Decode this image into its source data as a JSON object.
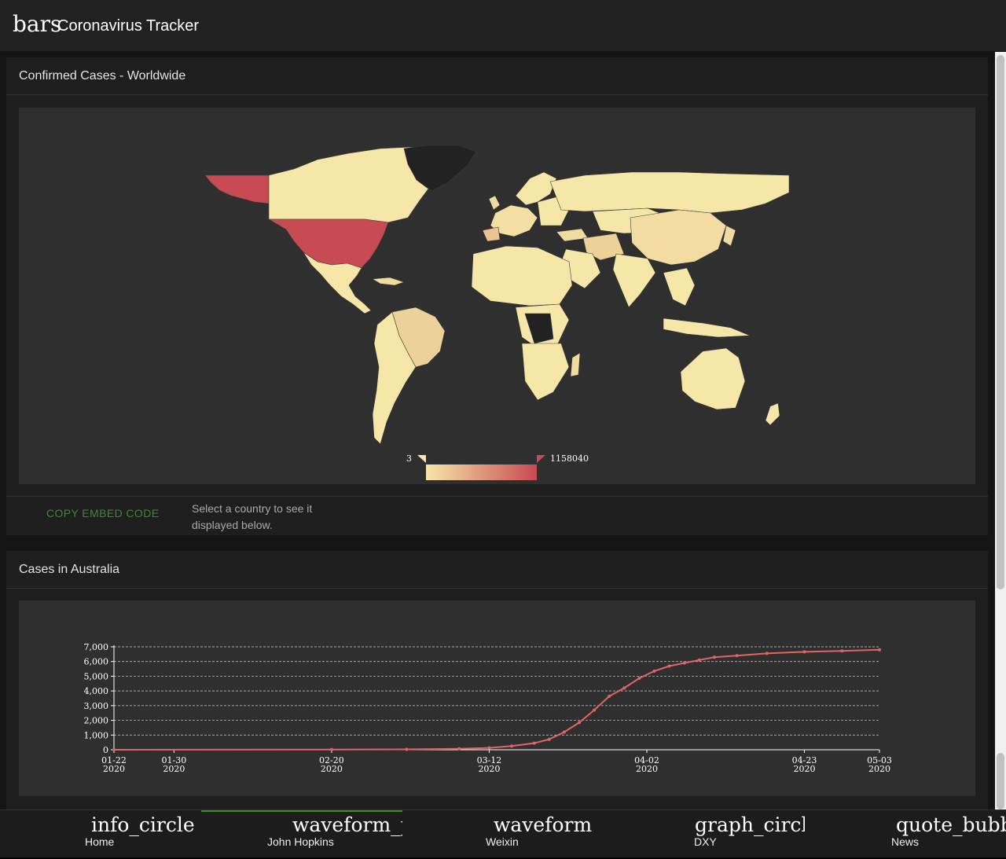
{
  "header": {
    "menu_icon": "bars",
    "title": "Coronavirus Tracker"
  },
  "colors": {
    "accent": "#3a8a33",
    "map_low": "#f6e7a8",
    "map_high": "#c84a52",
    "line": "#e06666"
  },
  "map_card": {
    "title": "Confirmed Cases - Worldwide",
    "legend_min": "3",
    "legend_max": "1158040",
    "copy_embed": "COPY EMBED CODE",
    "hint": "Select a country to see it displayed below."
  },
  "chart_card": {
    "title": "Cases in Australia"
  },
  "chart_data": {
    "type": "line",
    "title": "",
    "xlabel": "",
    "ylabel": "",
    "ylim": [
      0,
      7000
    ],
    "yticks": [
      "0",
      "1,000",
      "2,000",
      "3,000",
      "4,000",
      "5,000",
      "6,000",
      "7,000"
    ],
    "xticks": [
      {
        "date": "2020-01-22",
        "label": [
          "01-22",
          "2020"
        ]
      },
      {
        "date": "2020-01-30",
        "label": [
          "01-30",
          "2020"
        ]
      },
      {
        "date": "2020-02-20",
        "label": [
          "02-20",
          "2020"
        ]
      },
      {
        "date": "2020-03-12",
        "label": [
          "03-12",
          "2020"
        ]
      },
      {
        "date": "2020-04-02",
        "label": [
          "04-02",
          "2020"
        ]
      },
      {
        "date": "2020-04-23",
        "label": [
          "04-23",
          "2020"
        ]
      },
      {
        "date": "2020-05-03",
        "label": [
          "05-03",
          "2020"
        ]
      }
    ],
    "series": [
      {
        "points": [
          [
            "2020-01-22",
            0
          ],
          [
            "2020-02-20",
            15
          ],
          [
            "2020-03-01",
            26
          ],
          [
            "2020-03-08",
            70
          ],
          [
            "2020-03-12",
            128
          ],
          [
            "2020-03-15",
            250
          ],
          [
            "2020-03-18",
            450
          ],
          [
            "2020-03-20",
            710
          ],
          [
            "2020-03-22",
            1200
          ],
          [
            "2020-03-24",
            1850
          ],
          [
            "2020-03-26",
            2700
          ],
          [
            "2020-03-28",
            3640
          ],
          [
            "2020-03-30",
            4200
          ],
          [
            "2020-04-01",
            4860
          ],
          [
            "2020-04-03",
            5350
          ],
          [
            "2020-04-05",
            5690
          ],
          [
            "2020-04-07",
            5900
          ],
          [
            "2020-04-09",
            6100
          ],
          [
            "2020-04-11",
            6290
          ],
          [
            "2020-04-14",
            6400
          ],
          [
            "2020-04-18",
            6550
          ],
          [
            "2020-04-23",
            6660
          ],
          [
            "2020-04-28",
            6720
          ],
          [
            "2020-05-03",
            6800
          ]
        ]
      }
    ]
  },
  "bottom_nav": [
    {
      "icon": "info_circle",
      "label": "Home"
    },
    {
      "icon": "waveform_path",
      "label": "John Hopkins"
    },
    {
      "icon": "waveform",
      "label": "Weixin"
    },
    {
      "icon": "graph_circle",
      "label": "DXY"
    },
    {
      "icon": "quote_bubble",
      "label": "News"
    }
  ]
}
